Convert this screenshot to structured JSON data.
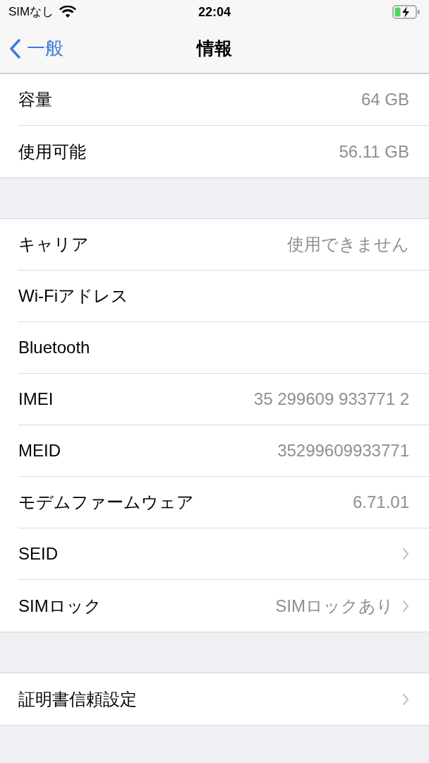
{
  "status_bar": {
    "carrier": "SIMなし",
    "time": "22:04",
    "charging": true
  },
  "nav_bar": {
    "back": "一般",
    "title": "情報"
  },
  "sections": [
    {
      "rows": [
        {
          "label": "容量",
          "value": "64 GB",
          "disclosure": false
        },
        {
          "label": "使用可能",
          "value": "56.11 GB",
          "disclosure": false
        }
      ]
    },
    {
      "rows": [
        {
          "label": "キャリア",
          "value": "使用できません",
          "disclosure": false
        },
        {
          "label": "Wi-Fiアドレス",
          "disclosure": false
        },
        {
          "label": "Bluetooth",
          "disclosure": false
        },
        {
          "label": "IMEI",
          "value": "35 299609 933771 2",
          "disclosure": false
        },
        {
          "label": "MEID",
          "value": "35299609933771",
          "disclosure": false
        },
        {
          "label": "モデムファームウェア",
          "value": "6.71.01",
          "disclosure": false
        },
        {
          "label": "SEID",
          "disclosure": true
        },
        {
          "label": "SIMロック",
          "value": "SIMロックあり",
          "disclosure": true
        }
      ]
    },
    {
      "rows": [
        {
          "label": "証明書信頼設定",
          "disclosure": true
        }
      ]
    }
  ]
}
